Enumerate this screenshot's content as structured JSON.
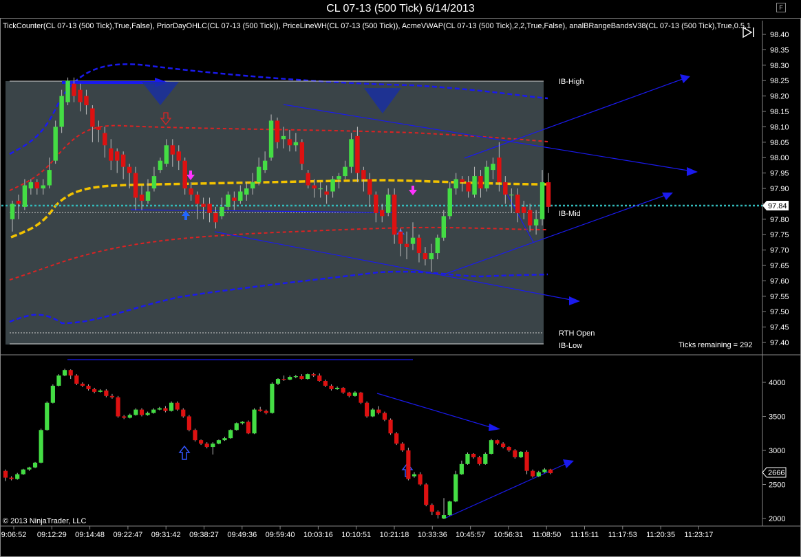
{
  "window": {
    "title": "CL 07-13 (500 Tick)  6/14/2013",
    "button": "F"
  },
  "indicators_line": "TickCounter(CL 07-13 (500 Tick),True,False), PriorDayOHLC(CL 07-13 (500 Tick)), PriceLineWH(CL 07-13 (500 Tick)), AcmeVWAP(CL 07-13 (500 Tick),2,2,True,False), analBRangeBandsV38(CL 07-13 (500 Tick),True,0.5,1",
  "labels": {
    "ib_high": "IB-High",
    "ib_mid": "IB-Mid",
    "rth_open": "RTH Open",
    "ib_low": "IB-Low",
    "ticks_remaining": "Ticks remaining = 292",
    "copyright": "© 2013 NinjaTrader, LLC",
    "last_price": "97.84",
    "lower_last": "2666"
  },
  "colors": {
    "up": "#44dd44",
    "down": "#dd1111",
    "vwap": "#f2c200",
    "band_red": "#dd2222",
    "band_blue": "#1a1aee",
    "price_line": "#33bbbb",
    "ib_box": "#3a4448"
  },
  "chart_data": [
    {
      "type": "candlestick",
      "title": "",
      "y_ticks": [
        "98.40",
        "98.35",
        "98.30",
        "98.25",
        "98.20",
        "98.15",
        "98.10",
        "98.05",
        "98.00",
        "97.95",
        "97.90",
        "97.85",
        "97.80",
        "97.75",
        "97.70",
        "97.65",
        "97.60",
        "97.55",
        "97.50",
        "97.45",
        "97.40"
      ],
      "ylim": [
        97.38,
        98.42
      ],
      "ib_high": 98.25,
      "ib_mid": 97.82,
      "ib_low": 97.39,
      "rth_open": 97.43,
      "last_price": 97.84,
      "candles": [
        [
          97.8,
          97.85,
          97.76,
          97.86
        ],
        [
          97.86,
          97.85,
          97.8,
          97.88
        ],
        [
          97.84,
          97.91,
          97.83,
          97.93
        ],
        [
          97.9,
          97.92,
          97.88,
          97.93
        ],
        [
          97.92,
          97.9,
          97.88,
          97.93
        ],
        [
          97.9,
          97.91,
          97.88,
          97.93
        ],
        [
          97.91,
          97.96,
          97.9,
          98.0
        ],
        [
          97.99,
          98.1,
          97.98,
          98.12
        ],
        [
          98.1,
          98.2,
          98.08,
          98.22
        ],
        [
          98.18,
          98.25,
          98.17,
          98.26
        ],
        [
          98.24,
          98.2,
          98.18,
          98.26
        ],
        [
          98.22,
          98.18,
          98.15,
          98.24
        ],
        [
          98.2,
          98.17,
          98.14,
          98.22
        ],
        [
          98.16,
          98.1,
          98.05,
          98.17
        ],
        [
          98.1,
          98.09,
          98.05,
          98.12
        ],
        [
          98.08,
          98.04,
          98.0,
          98.1
        ],
        [
          98.03,
          97.99,
          97.96,
          98.06
        ],
        [
          98.02,
          97.99,
          97.95,
          98.03
        ],
        [
          98.01,
          97.97,
          97.93,
          98.02
        ],
        [
          97.97,
          97.95,
          97.9,
          97.98
        ],
        [
          97.95,
          97.87,
          97.83,
          97.97
        ],
        [
          97.88,
          97.86,
          97.83,
          97.91
        ],
        [
          97.86,
          97.89,
          97.85,
          97.93
        ],
        [
          97.9,
          97.94,
          97.89,
          97.97
        ],
        [
          97.96,
          97.99,
          97.95,
          98.0
        ],
        [
          97.98,
          98.04,
          97.97,
          98.06
        ],
        [
          98.04,
          98.01,
          97.97,
          98.06
        ],
        [
          98.02,
          97.99,
          97.96,
          98.04
        ],
        [
          97.99,
          97.9,
          97.88,
          98.0
        ],
        [
          97.9,
          97.88,
          97.86,
          97.92
        ],
        [
          97.88,
          97.85,
          97.8,
          97.89
        ],
        [
          97.85,
          97.84,
          97.8,
          97.87
        ],
        [
          97.85,
          97.82,
          97.79,
          97.87
        ],
        [
          97.82,
          97.79,
          97.77,
          97.84
        ],
        [
          97.81,
          97.84,
          97.8,
          97.87
        ],
        [
          97.84,
          97.88,
          97.83,
          97.89
        ],
        [
          97.87,
          97.86,
          97.83,
          97.89
        ],
        [
          97.86,
          97.89,
          97.85,
          97.91
        ],
        [
          97.88,
          97.9,
          97.86,
          97.92
        ],
        [
          97.9,
          97.92,
          97.88,
          97.95
        ],
        [
          97.92,
          97.97,
          97.91,
          98.0
        ],
        [
          97.96,
          97.99,
          97.95,
          98.02
        ],
        [
          98.0,
          98.12,
          97.99,
          98.14
        ],
        [
          98.12,
          98.05,
          98.03,
          98.13
        ],
        [
          98.06,
          98.07,
          98.03,
          98.1
        ],
        [
          98.06,
          98.04,
          98.02,
          98.09
        ],
        [
          98.04,
          98.05,
          98.02,
          98.08
        ],
        [
          98.05,
          97.98,
          97.96,
          98.06
        ],
        [
          97.95,
          97.91,
          97.9,
          97.96
        ],
        [
          97.91,
          97.9,
          97.87,
          97.93
        ],
        [
          97.9,
          97.9,
          97.87,
          97.92
        ],
        [
          97.89,
          97.88,
          97.85,
          97.91
        ],
        [
          97.89,
          97.93,
          97.87,
          97.94
        ],
        [
          97.93,
          97.94,
          97.9,
          97.95
        ],
        [
          97.94,
          97.97,
          97.93,
          97.99
        ],
        [
          97.97,
          98.06,
          97.95,
          98.08
        ],
        [
          98.07,
          97.95,
          97.92,
          98.1
        ],
        [
          97.96,
          97.93,
          97.89,
          97.97
        ],
        [
          97.93,
          97.88,
          97.84,
          97.95
        ],
        [
          97.88,
          97.82,
          97.79,
          97.89
        ],
        [
          97.83,
          97.81,
          97.79,
          97.85
        ],
        [
          97.82,
          97.88,
          97.81,
          97.9
        ],
        [
          97.88,
          97.75,
          97.72,
          97.9
        ],
        [
          97.76,
          97.72,
          97.68,
          97.77
        ],
        [
          97.72,
          97.71,
          97.67,
          97.76
        ],
        [
          97.72,
          97.74,
          97.7,
          97.79
        ],
        [
          97.74,
          97.69,
          97.66,
          97.75
        ],
        [
          97.69,
          97.67,
          97.65,
          97.71
        ],
        [
          97.67,
          97.69,
          97.63,
          97.72
        ],
        [
          97.69,
          97.74,
          97.67,
          97.75
        ],
        [
          97.74,
          97.81,
          97.73,
          97.83
        ],
        [
          97.81,
          97.9,
          97.8,
          97.92
        ],
        [
          97.9,
          97.93,
          97.88,
          97.95
        ],
        [
          97.93,
          97.92,
          97.89,
          97.94
        ],
        [
          97.92,
          97.89,
          97.87,
          97.94
        ],
        [
          97.88,
          97.94,
          97.87,
          97.97
        ],
        [
          97.94,
          97.9,
          97.87,
          97.96
        ],
        [
          97.9,
          97.97,
          97.89,
          97.99
        ],
        [
          97.96,
          97.98,
          97.93,
          98.0
        ],
        [
          98.0,
          97.92,
          97.89,
          98.05
        ],
        [
          97.92,
          97.88,
          97.85,
          97.94
        ],
        [
          97.88,
          97.88,
          97.82,
          97.9
        ],
        [
          97.88,
          97.82,
          97.79,
          97.9
        ],
        [
          97.84,
          97.82,
          97.8,
          97.86
        ],
        [
          97.83,
          97.78,
          97.76,
          97.85
        ],
        [
          97.78,
          97.8,
          97.75,
          97.83
        ],
        [
          97.8,
          97.92,
          97.78,
          97.96
        ],
        [
          97.92,
          97.84,
          97.82,
          97.95
        ]
      ]
    },
    {
      "type": "candlestick",
      "title": "",
      "y_ticks": [
        "4000",
        "3500",
        "3000",
        "2500",
        "2000"
      ],
      "ylim": [
        1960,
        4240
      ],
      "last_value": 2666,
      "x_ticks": [
        "9:06:52",
        "09:12:29",
        "09:14:48",
        "09:22:47",
        "09:31:42",
        "09:38:27",
        "09:49:36",
        "09:59:40",
        "10:03:16",
        "10:10:51",
        "10:21:18",
        "10:33:36",
        "10:45:57",
        "10:56:31",
        "11:08:50",
        "11:15:11",
        "11:17:53",
        "11:20:35",
        "11:23:17"
      ],
      "candles": [
        [
          2700,
          2600,
          2550,
          2720
        ],
        [
          2600,
          2580,
          2560,
          2620
        ],
        [
          2580,
          2650,
          2570,
          2670
        ],
        [
          2650,
          2720,
          2640,
          2730
        ],
        [
          2720,
          2750,
          2700,
          2760
        ],
        [
          2750,
          2820,
          2740,
          2830
        ],
        [
          2820,
          3300,
          2810,
          3320
        ],
        [
          3300,
          3700,
          3290,
          3720
        ],
        [
          3700,
          3950,
          3690,
          3970
        ],
        [
          3950,
          4100,
          3940,
          4120
        ],
        [
          4100,
          4180,
          4090,
          4200
        ],
        [
          4180,
          4100,
          4050,
          4190
        ],
        [
          4100,
          3980,
          3960,
          4120
        ],
        [
          3980,
          3950,
          3930,
          4000
        ],
        [
          3950,
          3900,
          3880,
          3970
        ],
        [
          3900,
          3860,
          3840,
          3920
        ],
        [
          3860,
          3880,
          3850,
          3900
        ],
        [
          3880,
          3800,
          3780,
          3900
        ],
        [
          3800,
          3780,
          3760,
          3830
        ],
        [
          3780,
          3500,
          3480,
          3800
        ],
        [
          3500,
          3480,
          3460,
          3520
        ],
        [
          3480,
          3520,
          3470,
          3540
        ],
        [
          3520,
          3600,
          3510,
          3620
        ],
        [
          3600,
          3520,
          3500,
          3620
        ],
        [
          3520,
          3550,
          3510,
          3570
        ],
        [
          3550,
          3600,
          3540,
          3620
        ],
        [
          3600,
          3620,
          3590,
          3640
        ],
        [
          3620,
          3580,
          3560,
          3650
        ],
        [
          3580,
          3700,
          3570,
          3720
        ],
        [
          3700,
          3600,
          3580,
          3720
        ],
        [
          3600,
          3500,
          3480,
          3620
        ],
        [
          3500,
          3300,
          3280,
          3520
        ],
        [
          3300,
          3150,
          3130,
          3320
        ],
        [
          3150,
          3100,
          3080,
          3160
        ],
        [
          3100,
          3050,
          3030,
          3120
        ],
        [
          3050,
          3100,
          2940,
          3120
        ],
        [
          3100,
          3150,
          3090,
          3160
        ],
        [
          3150,
          3180,
          3140,
          3200
        ],
        [
          3180,
          3300,
          3170,
          3310
        ],
        [
          3300,
          3400,
          3290,
          3410
        ],
        [
          3400,
          3420,
          3380,
          3430
        ],
        [
          3420,
          3250,
          3240,
          3440
        ],
        [
          3250,
          3600,
          3240,
          3620
        ],
        [
          3600,
          3580,
          3570,
          3640
        ],
        [
          3580,
          3550,
          3530,
          3600
        ],
        [
          3550,
          3980,
          3540,
          4000
        ],
        [
          3980,
          4050,
          3960,
          4060
        ],
        [
          4050,
          4040,
          4020,
          4100
        ],
        [
          4040,
          4080,
          4030,
          4100
        ],
        [
          4080,
          4090,
          4060,
          4110
        ],
        [
          4090,
          4050,
          4040,
          4120
        ],
        [
          4050,
          4120,
          4040,
          4130
        ],
        [
          4120,
          4100,
          4080,
          4140
        ],
        [
          4100,
          4020,
          4010,
          4130
        ],
        [
          4020,
          3950,
          3930,
          4040
        ],
        [
          3950,
          3900,
          3880,
          3970
        ],
        [
          3900,
          3920,
          3890,
          3940
        ],
        [
          3920,
          3850,
          3830,
          3930
        ],
        [
          3850,
          3800,
          3780,
          3860
        ],
        [
          3800,
          3850,
          3790,
          3870
        ],
        [
          3850,
          3700,
          3680,
          3860
        ],
        [
          3700,
          3500,
          3480,
          3720
        ],
        [
          3500,
          3600,
          3490,
          3620
        ],
        [
          3600,
          3550,
          3530,
          3650
        ],
        [
          3550,
          3450,
          3430,
          3570
        ],
        [
          3450,
          3250,
          3230,
          3470
        ],
        [
          3250,
          3100,
          3080,
          3270
        ],
        [
          3100,
          3000,
          2980,
          3120
        ],
        [
          3000,
          2580,
          2560,
          3040
        ],
        [
          2620,
          2650,
          2600,
          2680
        ],
        [
          2650,
          2500,
          2480,
          2680
        ],
        [
          2500,
          2200,
          2180,
          2520
        ],
        [
          2200,
          2100,
          2050,
          2220
        ],
        [
          2100,
          2050,
          2000,
          2120
        ],
        [
          2000,
          2050,
          1990,
          2300
        ],
        [
          2050,
          2250,
          2040,
          2260
        ],
        [
          2250,
          2650,
          2240,
          2700
        ],
        [
          2650,
          2800,
          2640,
          2850
        ],
        [
          2800,
          2950,
          2790,
          2970
        ],
        [
          2950,
          2900,
          2880,
          2960
        ],
        [
          2900,
          2800,
          2780,
          2920
        ],
        [
          2800,
          2950,
          2790,
          2970
        ],
        [
          2950,
          3150,
          2940,
          3170
        ],
        [
          3150,
          3100,
          3080,
          3160
        ],
        [
          3100,
          3050,
          3030,
          3120
        ],
        [
          3050,
          3000,
          2980,
          3060
        ],
        [
          3000,
          2900,
          2880,
          3020
        ],
        [
          2900,
          2980,
          2890,
          2990
        ],
        [
          2980,
          2700,
          2650,
          3000
        ],
        [
          2700,
          2620,
          2600,
          2720
        ],
        [
          2620,
          2680,
          2610,
          2700
        ],
        [
          2680,
          2720,
          2670,
          2740
        ],
        [
          2720,
          2666,
          2650,
          2730
        ]
      ]
    }
  ]
}
